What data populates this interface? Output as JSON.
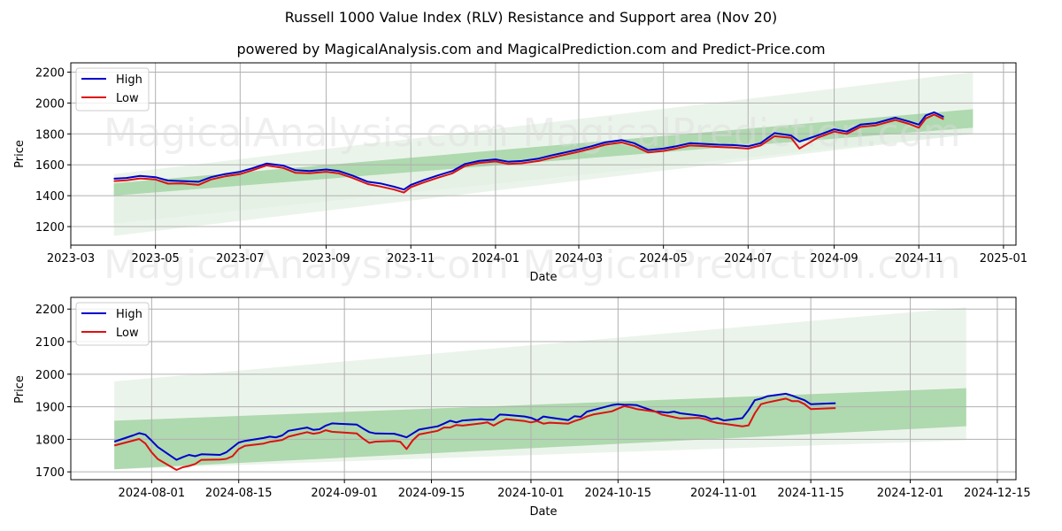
{
  "title": "Russell 1000 Value Index (RLV) Resistance and Support area (Nov 20)",
  "subtitle": "powered by MagicalAnalysis.com and MagicalPrediction.com and Predict-Price.com",
  "watermarks": [
    "MagicalAnalysis.com",
    "MagicalPrediction.com"
  ],
  "colors": {
    "high": "#0000cc",
    "low": "#dd1111",
    "band_dark": "#a5d3a5",
    "band_light": "#e3f0e3",
    "grid": "#b0b0b0"
  },
  "chart_data": [
    {
      "type": "line",
      "title": "",
      "xlabel": "Date",
      "ylabel": "Price",
      "grid": true,
      "legend": {
        "placement": "top-left",
        "entries": [
          "High",
          "Low"
        ]
      },
      "x_range": [
        "2023-03-01",
        "2025-01-10"
      ],
      "ylim": [
        1080,
        2260
      ],
      "x_ticks": [
        "2023-03",
        "2023-05",
        "2023-07",
        "2023-09",
        "2023-11",
        "2024-01",
        "2024-03",
        "2024-05",
        "2024-07",
        "2024-09",
        "2024-11",
        "2025-01"
      ],
      "x_tick_dates": [
        "2023-03-01",
        "2023-05-01",
        "2023-07-01",
        "2023-09-01",
        "2023-11-01",
        "2024-01-01",
        "2024-03-01",
        "2024-05-01",
        "2024-07-01",
        "2024-09-01",
        "2024-11-01",
        "2025-01-01"
      ],
      "y_ticks": [
        1200,
        1400,
        1600,
        1800,
        2000,
        2200
      ],
      "bands": [
        {
          "name": "outer-band",
          "x": [
            "2023-04-01",
            "2024-12-10"
          ],
          "upper": [
            1540,
            2200
          ],
          "lower": [
            1140,
            1800
          ]
        },
        {
          "name": "inner-band",
          "x": [
            "2023-04-01",
            "2024-12-10"
          ],
          "upper": [
            1480,
            1960
          ],
          "lower": [
            1400,
            1840
          ]
        },
        {
          "name": "lower-light-band",
          "x": [
            "2023-04-01",
            "2024-12-10"
          ],
          "upper": [
            1400,
            1840
          ],
          "lower": [
            1220,
            1800
          ]
        }
      ],
      "x": [
        "2023-04-01",
        "2023-04-10",
        "2023-04-20",
        "2023-05-01",
        "2023-05-10",
        "2023-05-20",
        "2023-06-01",
        "2023-06-10",
        "2023-06-20",
        "2023-07-01",
        "2023-07-10",
        "2023-07-20",
        "2023-08-01",
        "2023-08-10",
        "2023-08-20",
        "2023-09-01",
        "2023-09-10",
        "2023-09-20",
        "2023-10-01",
        "2023-10-10",
        "2023-10-20",
        "2023-10-27",
        "2023-11-01",
        "2023-11-10",
        "2023-11-20",
        "2023-12-01",
        "2023-12-10",
        "2023-12-20",
        "2024-01-01",
        "2024-01-10",
        "2024-01-20",
        "2024-02-01",
        "2024-02-10",
        "2024-02-20",
        "2024-03-01",
        "2024-03-10",
        "2024-03-20",
        "2024-04-01",
        "2024-04-10",
        "2024-04-20",
        "2024-05-01",
        "2024-05-10",
        "2024-05-20",
        "2024-06-01",
        "2024-06-10",
        "2024-06-20",
        "2024-07-01",
        "2024-07-10",
        "2024-07-20",
        "2024-08-01",
        "2024-08-07",
        "2024-08-20",
        "2024-09-01",
        "2024-09-10",
        "2024-09-20",
        "2024-10-01",
        "2024-10-15",
        "2024-10-25",
        "2024-11-01",
        "2024-11-06",
        "2024-11-12",
        "2024-11-19"
      ],
      "series": [
        {
          "name": "High",
          "values": [
            1510,
            1515,
            1528,
            1520,
            1498,
            1495,
            1490,
            1520,
            1540,
            1555,
            1578,
            1608,
            1595,
            1565,
            1560,
            1570,
            1560,
            1530,
            1490,
            1480,
            1458,
            1440,
            1470,
            1500,
            1530,
            1560,
            1605,
            1625,
            1635,
            1620,
            1625,
            1640,
            1660,
            1680,
            1700,
            1720,
            1745,
            1760,
            1740,
            1695,
            1705,
            1720,
            1740,
            1735,
            1730,
            1728,
            1720,
            1740,
            1805,
            1790,
            1750,
            1790,
            1830,
            1815,
            1860,
            1870,
            1905,
            1880,
            1860,
            1920,
            1940,
            1910
          ]
        },
        {
          "name": "Low",
          "values": [
            1495,
            1500,
            1512,
            1505,
            1478,
            1480,
            1470,
            1505,
            1525,
            1540,
            1565,
            1596,
            1580,
            1548,
            1545,
            1555,
            1545,
            1515,
            1475,
            1460,
            1440,
            1420,
            1455,
            1485,
            1515,
            1545,
            1592,
            1612,
            1622,
            1606,
            1610,
            1625,
            1645,
            1665,
            1685,
            1705,
            1730,
            1745,
            1722,
            1680,
            1690,
            1705,
            1725,
            1720,
            1715,
            1712,
            1705,
            1725,
            1785,
            1775,
            1705,
            1775,
            1815,
            1800,
            1845,
            1855,
            1890,
            1865,
            1840,
            1900,
            1925,
            1895
          ]
        }
      ]
    },
    {
      "type": "line",
      "title": "",
      "xlabel": "Date",
      "ylabel": "Price",
      "grid": true,
      "legend": {
        "placement": "top-left",
        "entries": [
          "High",
          "Low"
        ]
      },
      "x_range": [
        "2024-07-19",
        "2024-12-18"
      ],
      "ylim": [
        1676,
        2236
      ],
      "x_ticks": [
        "2024-08-01",
        "2024-08-15",
        "2024-09-01",
        "2024-09-15",
        "2024-10-01",
        "2024-10-15",
        "2024-11-01",
        "2024-11-15",
        "2024-12-01",
        "2024-12-15"
      ],
      "y_ticks": [
        1700,
        1800,
        1900,
        2000,
        2100,
        2200
      ],
      "bands": [
        {
          "name": "outer-band",
          "x": [
            "2024-07-26",
            "2024-12-10"
          ],
          "upper": [
            1978,
            2205
          ],
          "lower": [
            1708,
            1797
          ]
        },
        {
          "name": "inner-band",
          "x": [
            "2024-07-26",
            "2024-12-10"
          ],
          "upper": [
            1857,
            1957
          ],
          "lower": [
            1708,
            1840
          ]
        }
      ],
      "x": [
        "2024-07-26",
        "2024-07-29",
        "2024-07-30",
        "2024-07-31",
        "2024-08-01",
        "2024-08-02",
        "2024-08-05",
        "2024-08-06",
        "2024-08-07",
        "2024-08-08",
        "2024-08-09",
        "2024-08-12",
        "2024-08-13",
        "2024-08-14",
        "2024-08-15",
        "2024-08-16",
        "2024-08-19",
        "2024-08-20",
        "2024-08-21",
        "2024-08-22",
        "2024-08-23",
        "2024-08-26",
        "2024-08-27",
        "2024-08-28",
        "2024-08-29",
        "2024-08-30",
        "2024-09-03",
        "2024-09-04",
        "2024-09-05",
        "2024-09-06",
        "2024-09-09",
        "2024-09-10",
        "2024-09-11",
        "2024-09-12",
        "2024-09-13",
        "2024-09-16",
        "2024-09-17",
        "2024-09-18",
        "2024-09-19",
        "2024-09-20",
        "2024-09-23",
        "2024-09-24",
        "2024-09-25",
        "2024-09-26",
        "2024-09-27",
        "2024-09-30",
        "2024-10-01",
        "2024-10-02",
        "2024-10-03",
        "2024-10-04",
        "2024-10-07",
        "2024-10-08",
        "2024-10-09",
        "2024-10-10",
        "2024-10-11",
        "2024-10-14",
        "2024-10-15",
        "2024-10-16",
        "2024-10-17",
        "2024-10-18",
        "2024-10-21",
        "2024-10-22",
        "2024-10-23",
        "2024-10-24",
        "2024-10-25",
        "2024-10-28",
        "2024-10-29",
        "2024-10-30",
        "2024-10-31",
        "2024-11-01",
        "2024-11-04",
        "2024-11-05",
        "2024-11-06",
        "2024-11-07",
        "2024-11-08",
        "2024-11-11",
        "2024-11-12",
        "2024-11-13",
        "2024-11-14",
        "2024-11-15",
        "2024-11-18",
        "2024-11-19"
      ],
      "series": [
        {
          "name": "High",
          "values": [
            1793,
            1812,
            1819,
            1814,
            1796,
            1776,
            1737,
            1745,
            1752,
            1748,
            1754,
            1752,
            1760,
            1775,
            1790,
            1795,
            1804,
            1808,
            1806,
            1812,
            1826,
            1836,
            1829,
            1831,
            1842,
            1849,
            1845,
            1833,
            1822,
            1818,
            1817,
            1812,
            1806,
            1818,
            1830,
            1840,
            1848,
            1857,
            1852,
            1858,
            1862,
            1860,
            1860,
            1876,
            1875,
            1870,
            1866,
            1858,
            1870,
            1867,
            1859,
            1871,
            1869,
            1885,
            1890,
            1905,
            1908,
            1906,
            1906,
            1905,
            1885,
            1884,
            1882,
            1885,
            1880,
            1873,
            1870,
            1862,
            1865,
            1858,
            1865,
            1890,
            1920,
            1925,
            1932,
            1940,
            1934,
            1927,
            1920,
            1908,
            1910,
            1911
          ]
        },
        {
          "name": "Low",
          "values": [
            1781,
            1796,
            1801,
            1787,
            1760,
            1739,
            1706,
            1714,
            1718,
            1724,
            1737,
            1738,
            1740,
            1748,
            1770,
            1780,
            1787,
            1792,
            1795,
            1798,
            1808,
            1822,
            1817,
            1820,
            1828,
            1823,
            1818,
            1802,
            1789,
            1793,
            1795,
            1792,
            1770,
            1797,
            1815,
            1826,
            1836,
            1836,
            1844,
            1842,
            1849,
            1852,
            1842,
            1853,
            1862,
            1856,
            1852,
            1856,
            1848,
            1851,
            1848,
            1856,
            1862,
            1870,
            1876,
            1886,
            1894,
            1902,
            1898,
            1893,
            1885,
            1876,
            1872,
            1868,
            1864,
            1866,
            1862,
            1855,
            1850,
            1848,
            1840,
            1843,
            1880,
            1908,
            1913,
            1925,
            1917,
            1917,
            1908,
            1893,
            1895,
            1896
          ]
        }
      ]
    }
  ]
}
